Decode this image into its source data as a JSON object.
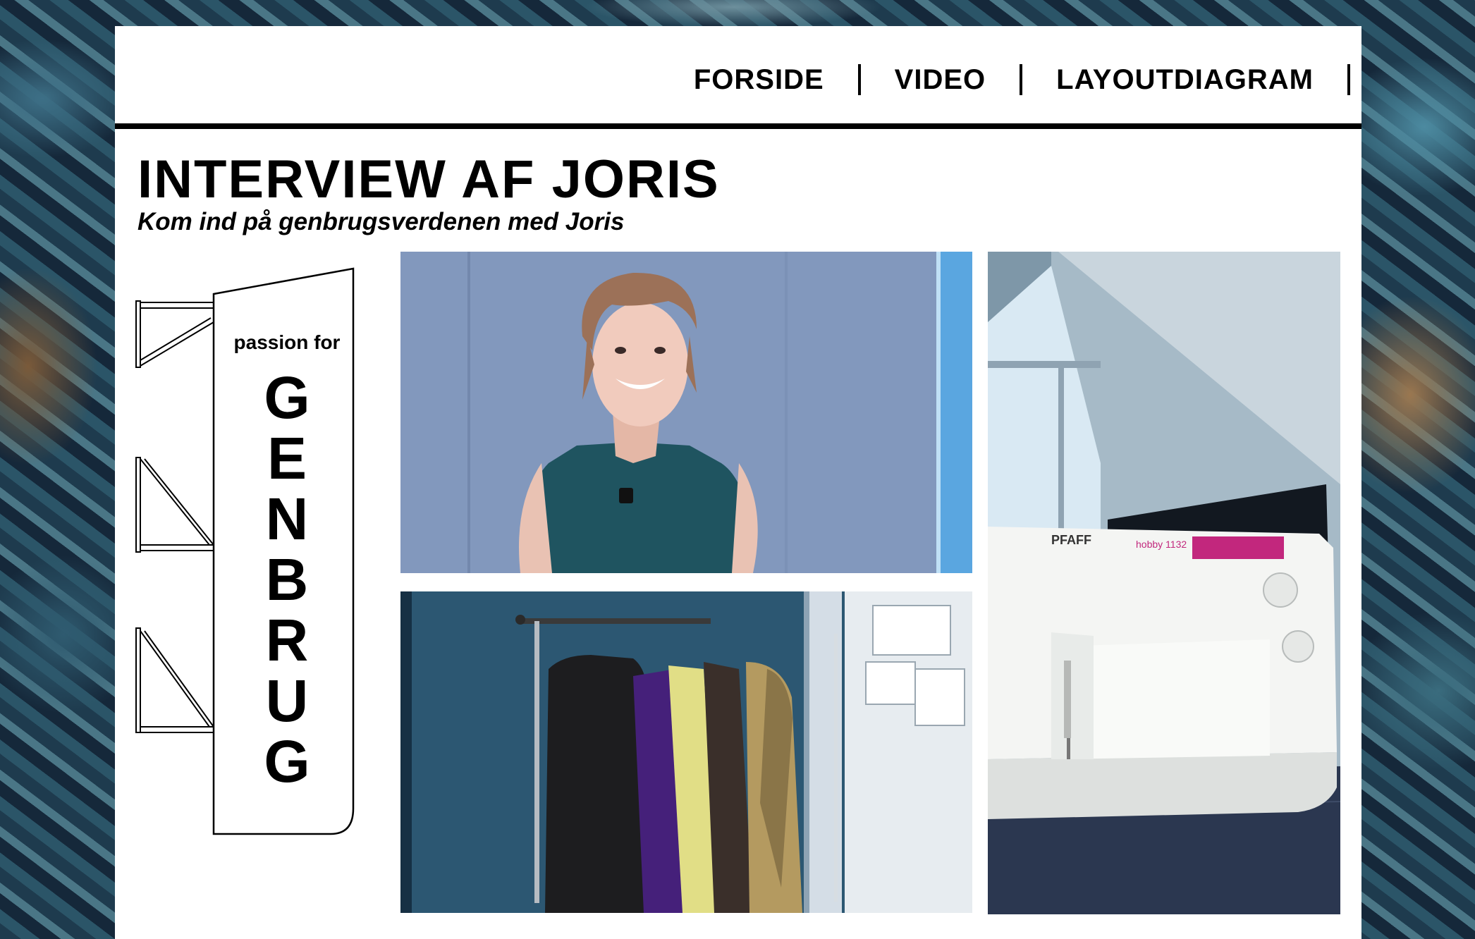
{
  "nav": {
    "items": [
      {
        "label": "FORSIDE"
      },
      {
        "label": "VIDEO"
      },
      {
        "label": "LAYOUTDIAGRAM"
      }
    ]
  },
  "header": {
    "title": "INTERVIEW AF JORIS",
    "subtitle": "Kom ind på genbrugsverdenen med Joris"
  },
  "logo": {
    "line1": "passion for",
    "letters": [
      "G",
      "E",
      "N",
      "B",
      "R",
      "U",
      "G"
    ]
  },
  "photos": {
    "sewing_machine_brand": "PFAFF",
    "sewing_machine_model": "hobby 1132"
  },
  "colors": {
    "accent": "#000000",
    "background": "#ffffff",
    "sewing_panel": "#c2277d"
  }
}
